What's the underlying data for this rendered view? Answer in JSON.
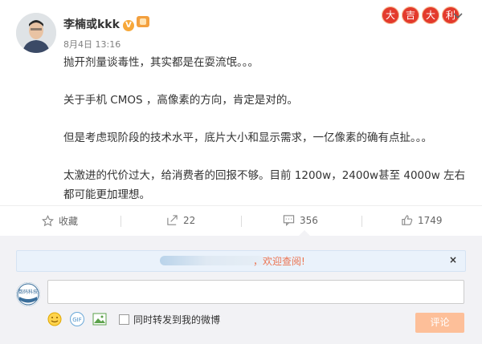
{
  "post": {
    "author": "李楠或kkk",
    "verified_icon": "V",
    "time": "8月4日 13:16",
    "lucky_chars": [
      "大",
      "吉",
      "大",
      "利"
    ],
    "paragraphs": [
      "抛开剂量谈毒性，其实都是在耍流氓。。。",
      "关于手机 CMOS ，高像素的方向，肯定是对的。",
      "但是考虑现阶段的技术水平，底片大小和显示需求，一亿像素的确有点扯。。。",
      "太激进的代价过大，给消费者的回报不够。目前 1200w，2400w甚至 4000w 左右都可能更加理想。"
    ]
  },
  "actions": {
    "favorite": "收藏",
    "forward_count": "22",
    "comment_count": "356",
    "like_count": "1749"
  },
  "comment": {
    "notice": "，欢迎查阅!",
    "close": "×",
    "avatar_text": "数码科技",
    "forward_check_label": "同时转发到我的微博",
    "submit_label": "评论"
  },
  "colors": {
    "accent": "#eb7350",
    "submit_bg": "#fdbf99",
    "lucky_red": "#e33a2c"
  }
}
